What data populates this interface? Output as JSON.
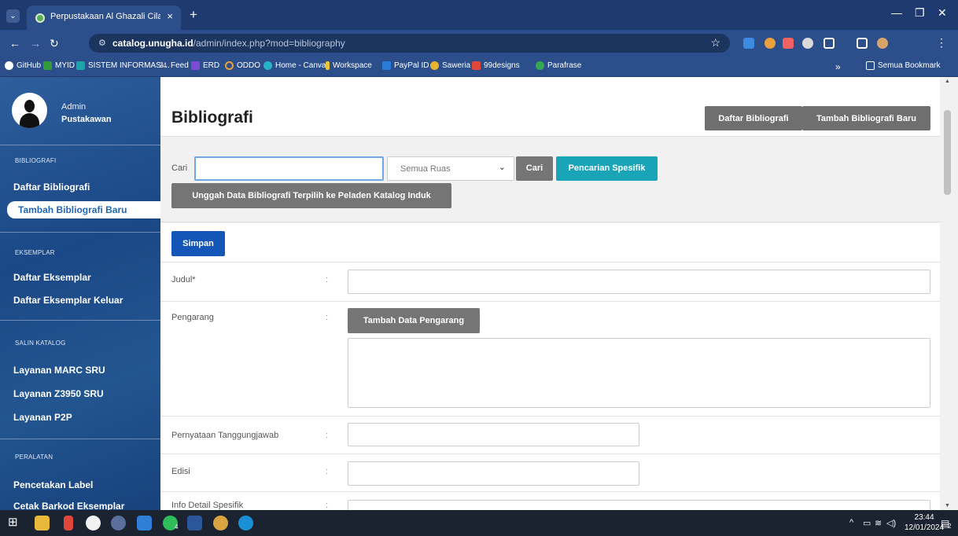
{
  "browser": {
    "tab_title": "Perpustakaan Al Ghazali Cilacap",
    "tab_close": "×",
    "new_tab": "+",
    "url_domain": "catalog.unugha.id",
    "url_path": "/admin/index.php?mod=bibliography",
    "bookmarks": [
      "GitHub",
      "MYID",
      "SISTEM INFORMASI...",
      "Feed",
      "ERD",
      "ODDO",
      "Home - Canva",
      "Workspace",
      "PayPal ID",
      "Saweria",
      "99designs",
      "Parafrase"
    ],
    "more_bookmarks": "»",
    "all_bookmarks": "Semua Bookmark"
  },
  "user": {
    "name": "Admin",
    "role": "Pustakawan"
  },
  "sidebar": {
    "sections": [
      {
        "title": "BIBLIOGRAFI",
        "items": [
          "Daftar Bibliografi",
          "Tambah Bibliografi Baru"
        ]
      },
      {
        "title": "EKSEMPLAR",
        "items": [
          "Daftar Eksemplar",
          "Daftar Eksemplar Keluar"
        ]
      },
      {
        "title": "SALIN KATALOG",
        "items": [
          "Layanan MARC SRU",
          "Layanan Z3950 SRU",
          "Layanan P2P"
        ]
      },
      {
        "title": "PERALATAN",
        "items": [
          "Pencetakan Label",
          "Cetak Barkod Eksemplar"
        ]
      }
    ],
    "active_item": "Tambah Bibliografi Baru"
  },
  "header": {
    "title": "Bibliografi",
    "btn_list": "Daftar Bibliografi",
    "btn_add": "Tambah Bibliografi Baru"
  },
  "search": {
    "label": "Cari",
    "value": "",
    "field_select": "Semua Ruas",
    "btn_search": "Cari",
    "btn_specific": "Pencarian Spesifik",
    "btn_upload": "Unggah Data Bibliografi Terpilih ke Peladen Katalog Induk"
  },
  "form": {
    "save": "Simpan",
    "colon": ":",
    "title_label": "Judul*",
    "author_label": "Pengarang",
    "add_author": "Tambah Data Pengarang",
    "responsibility_label": "Pernyataan Tanggungjawab",
    "edition_label": "Edisi",
    "detail_label": "Info Detail Spesifik"
  },
  "taskbar": {
    "time": "23:44",
    "date": "12/01/2024",
    "notif_count": "2",
    "whatsapp_count": "4"
  },
  "colors": {
    "sidebar": "#1c4a8a",
    "accent_teal": "#19a4b8",
    "primary_blue": "#1456b8",
    "gray_button": "#757575",
    "browser_chrome": "#2c4f8c"
  }
}
